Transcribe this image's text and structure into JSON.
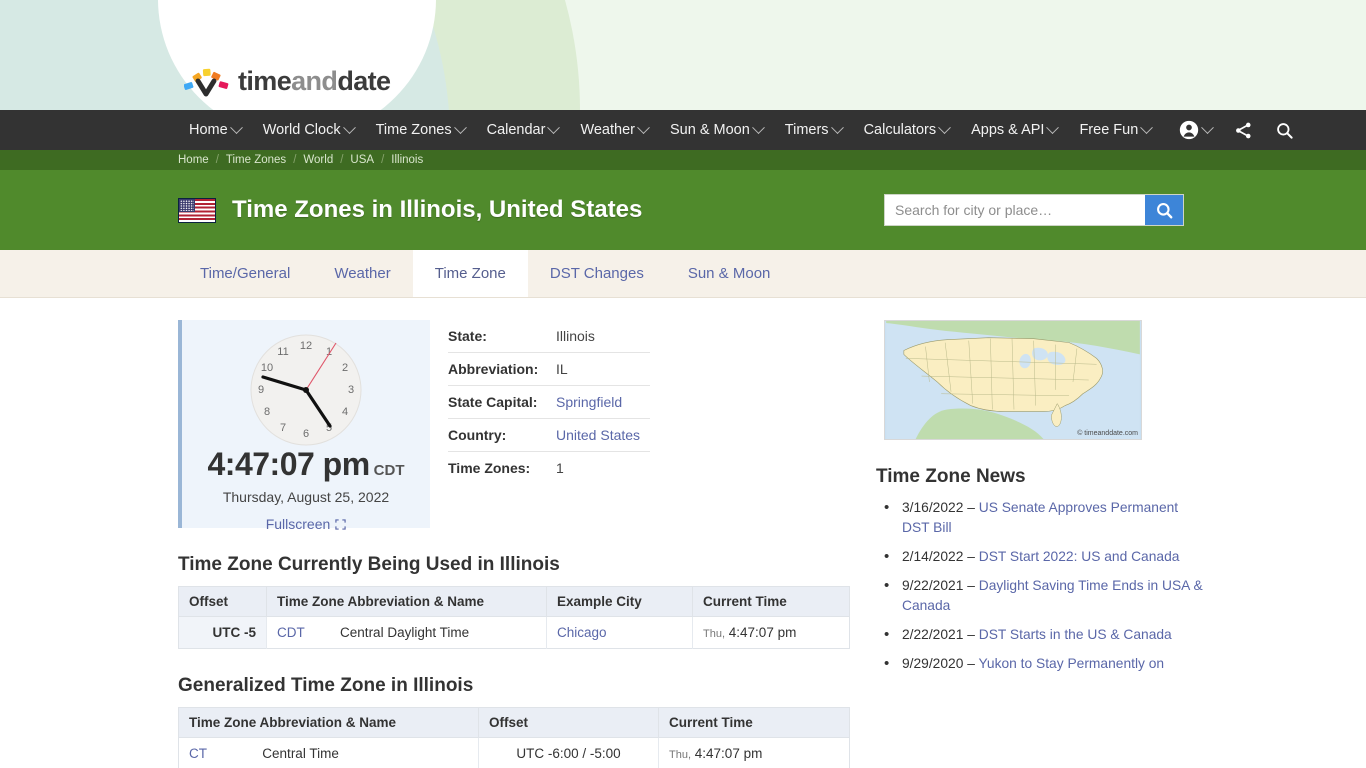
{
  "brand": {
    "name_part1": "time",
    "name_part2": "and",
    "name_part3": "date"
  },
  "nav": {
    "items": [
      {
        "label": "Home",
        "caret": true
      },
      {
        "label": "World Clock",
        "caret": true
      },
      {
        "label": "Time Zones",
        "caret": true
      },
      {
        "label": "Calendar",
        "caret": true
      },
      {
        "label": "Weather",
        "caret": true
      },
      {
        "label": "Sun & Moon",
        "caret": true
      },
      {
        "label": "Timers",
        "caret": true
      },
      {
        "label": "Calculators",
        "caret": true
      },
      {
        "label": "Apps & API",
        "caret": true
      },
      {
        "label": "Free Fun",
        "caret": true
      }
    ],
    "icons": [
      "account-icon",
      "share-icon",
      "search-icon"
    ]
  },
  "breadcrumb": {
    "items": [
      "Home",
      "Time Zones",
      "World",
      "USA",
      "Illinois"
    ]
  },
  "header": {
    "flag": "us-flag-icon",
    "title": "Time Zones in Illinois, United States"
  },
  "search": {
    "placeholder": "Search for city or place…",
    "value": "",
    "button_icon": "search-icon",
    "button_color": "#3d85d8"
  },
  "tabs": [
    {
      "label": "Time/General",
      "active": false
    },
    {
      "label": "Weather",
      "active": false
    },
    {
      "label": "Time Zone",
      "active": true
    },
    {
      "label": "DST Changes",
      "active": false
    },
    {
      "label": "Sun & Moon",
      "active": false
    }
  ],
  "clock": {
    "time": "4:47:07 pm",
    "timezone": "CDT",
    "date": "Thursday, August 25, 2022",
    "fullscreen_label": "Fullscreen",
    "fullscreen_icon": "expand-icon",
    "hour_numbers": [
      "12",
      "1",
      "2",
      "3",
      "4",
      "5",
      "6",
      "7",
      "8",
      "9",
      "10",
      "11"
    ],
    "accent_color": "#9ab6d6",
    "panel_color": "#eef4fb"
  },
  "info": {
    "rows": [
      {
        "label": "State:",
        "value": "Illinois",
        "link": false
      },
      {
        "label": "Abbreviation:",
        "value": "IL",
        "link": false
      },
      {
        "label": "State Capital:",
        "value": "Springfield",
        "link": true
      },
      {
        "label": "Country:",
        "value": "United States",
        "link": true
      },
      {
        "label": "Time Zones:",
        "value": "1",
        "link": false
      }
    ]
  },
  "map": {
    "credit": "© timeanddate.com",
    "name": "usa-map-image"
  },
  "current_zone": {
    "heading": "Time Zone Currently Being Used in Illinois",
    "columns": [
      "Offset",
      "Time Zone Abbreviation & Name",
      "Example City",
      "Current Time"
    ],
    "rows": [
      {
        "offset": "UTC -5",
        "abbr": "CDT",
        "name": "Central Daylight Time",
        "city": "Chicago",
        "day": "Thu,",
        "time": "4:47:07 pm"
      }
    ]
  },
  "generalized_zone": {
    "heading": "Generalized Time Zone in Illinois",
    "columns": [
      "Time Zone Abbreviation & Name",
      "Offset",
      "Current Time"
    ],
    "rows": [
      {
        "abbr": "CT",
        "name": "Central Time",
        "offset": "UTC -6:00 / -5:00",
        "day": "Thu,",
        "time": "4:47:07 pm"
      }
    ]
  },
  "news": {
    "heading": "Time Zone News",
    "items": [
      {
        "date": "3/16/2022",
        "dash": " – ",
        "title": "US Senate Approves Permanent DST Bill"
      },
      {
        "date": "2/14/2022",
        "dash": " – ",
        "title": "DST Start 2022: US and Canada"
      },
      {
        "date": "9/22/2021",
        "dash": " – ",
        "title": "Daylight Saving Time Ends in USA & Canada"
      },
      {
        "date": "2/22/2021",
        "dash": " – ",
        "title": "DST Starts in the US & Canada"
      },
      {
        "date": "9/29/2020",
        "dash": " – ",
        "title": "Yukon to Stay Permanently on"
      }
    ]
  },
  "colors": {
    "brand_green": "#508a2c",
    "breadcrumb_green": "#3e6b22",
    "nav_dark": "#333333",
    "tabbar_cream": "#f6f1e9",
    "link_blue": "#5a67a8"
  }
}
